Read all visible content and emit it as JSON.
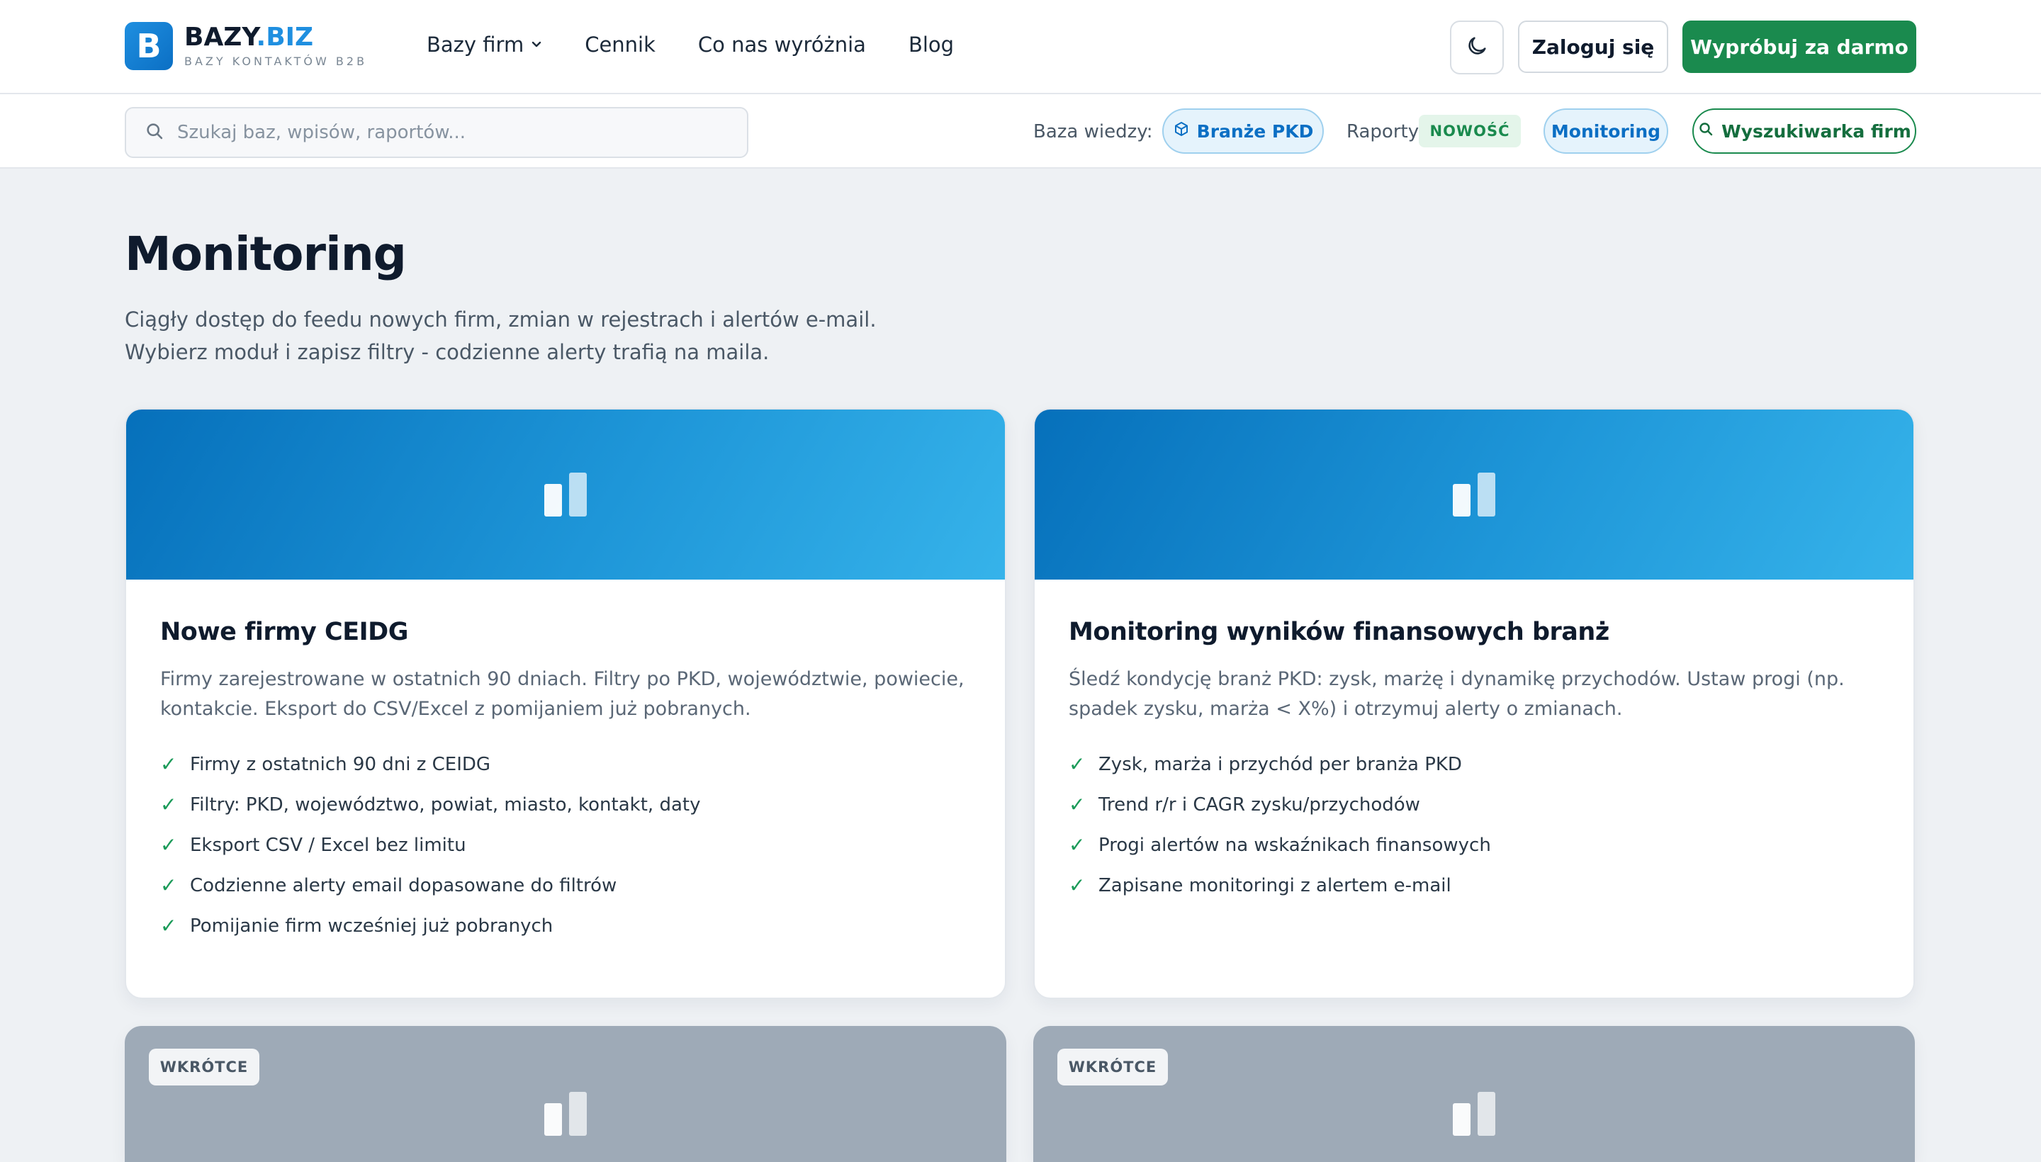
{
  "header": {
    "logo_letter": "B",
    "logo_name_main": "BAZY",
    "logo_name_accent": ".BIZ",
    "logo_tagline": "BAZY KONTAKTÓW B2B",
    "nav": [
      {
        "label": "Bazy firm",
        "has_dropdown": true
      },
      {
        "label": "Cennik"
      },
      {
        "label": "Co nas wyróżnia"
      },
      {
        "label": "Blog"
      }
    ],
    "theme_icon": "moon-icon",
    "login_label": "Zaloguj się",
    "trial_label": "Wypróbuj za darmo"
  },
  "subbar": {
    "search_placeholder": "Szukaj baz, wpisów, raportów...",
    "search_value": "",
    "kb_label": "Baza wiedzy:",
    "pkd_label": "Branże PKD",
    "raporty_label": "Raporty",
    "new_badge": "NOWOŚĆ",
    "monitoring_label": "Monitoring",
    "finder_label": "Wyszukiwarka firm"
  },
  "page": {
    "title": "Monitoring",
    "description": "Ciągły dostęp do feedu nowych firm, zmian w rejestrach i alertów e-mail. Wybierz moduł i zapisz filtry - codzienne alerty trafią na maila."
  },
  "cards": [
    {
      "title": "Nowe firmy CEIDG",
      "description": "Firmy zarejestrowane w ostatnich 90 dniach. Filtry po PKD, województwie, powiecie, kontakcie. Eksport do CSV/Excel z pomijaniem już pobranych.",
      "features": [
        "Firmy z ostatnich 90 dni z CEIDG",
        "Filtry: PKD, województwo, powiat, miasto, kontakt, daty",
        "Eksport CSV / Excel bez limitu",
        "Codzienne alerty email dopasowane do filtrów",
        "Pomijanie firm wcześniej już pobranych"
      ]
    },
    {
      "title": "Monitoring wyników finansowych branż",
      "description": "Śledź kondycję branż PKD: zysk, marżę i dynamikę przychodów. Ustaw progi (np. spadek zysku, marża < X%) i otrzymuj alerty o zmianach.",
      "features": [
        "Zysk, marża i przychód per branża PKD",
        "Trend r/r i CAGR zysku/przychodów",
        "Progi alertów na wskaźnikach finansowych",
        "Zapisane monitoringi z alertem e-mail"
      ]
    },
    {
      "badge": "WKRÓTCE"
    },
    {
      "badge": "WKRÓTCE"
    }
  ],
  "colors": {
    "brand_blue": "#1f8fe0",
    "brand_green": "#1a8a4e",
    "page_bg": "#eef1f4",
    "soon_card": "#9eaab7"
  }
}
